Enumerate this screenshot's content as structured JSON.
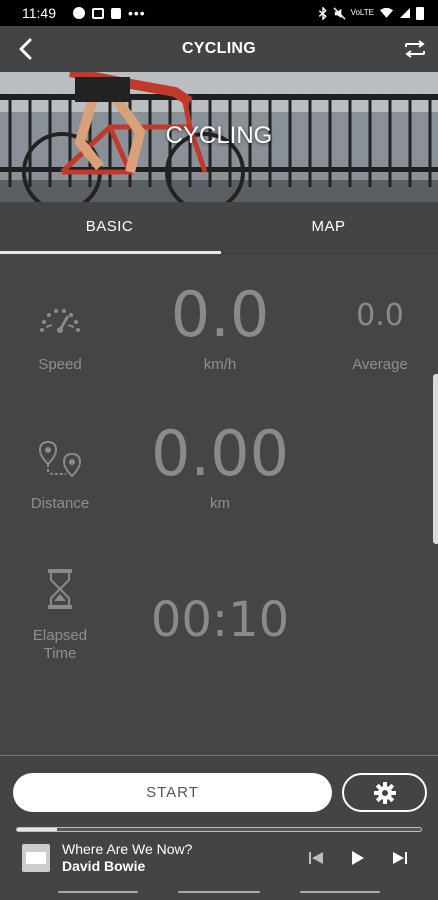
{
  "status_bar": {
    "time": "11:49",
    "left_icons": [
      "spotify-icon",
      "image-icon",
      "bag-icon",
      "more-icon"
    ],
    "right_icons": [
      "bluetooth-icon",
      "mute-icon",
      "volte-icon",
      "wifi-icon",
      "signal-icon",
      "battery-icon"
    ],
    "volte_text": "VoLTE"
  },
  "app_bar": {
    "title": "CYCLING",
    "back_icon": "chevron-left-icon",
    "switch_icon": "swap-arrows-icon"
  },
  "hero": {
    "title": "CYCLING"
  },
  "tabs": [
    {
      "label": "BASIC",
      "selected": true
    },
    {
      "label": "MAP",
      "selected": false
    }
  ],
  "metrics": {
    "speed": {
      "label": "Speed",
      "icon": "speedometer-icon",
      "value": "0.0",
      "unit": "km/h",
      "average_value": "0.0",
      "average_label": "Average"
    },
    "distance": {
      "label": "Distance",
      "icon": "route-pins-icon",
      "value": "0.00",
      "unit": "km"
    },
    "elapsed": {
      "label_line1": "Elapsed",
      "label_line2": "Time",
      "icon": "hourglass-icon",
      "value": "00:10"
    }
  },
  "actions": {
    "start_label": "START",
    "settings_icon": "gear-icon"
  },
  "player": {
    "track_title": "Where Are We Now?",
    "artist": "David Bowie",
    "progress": 0.1,
    "controls": [
      "previous-icon",
      "play-icon",
      "next-icon"
    ]
  },
  "colors": {
    "background": "#444444",
    "metric_text": "#8a8a8a",
    "accent_white": "#ffffff"
  }
}
